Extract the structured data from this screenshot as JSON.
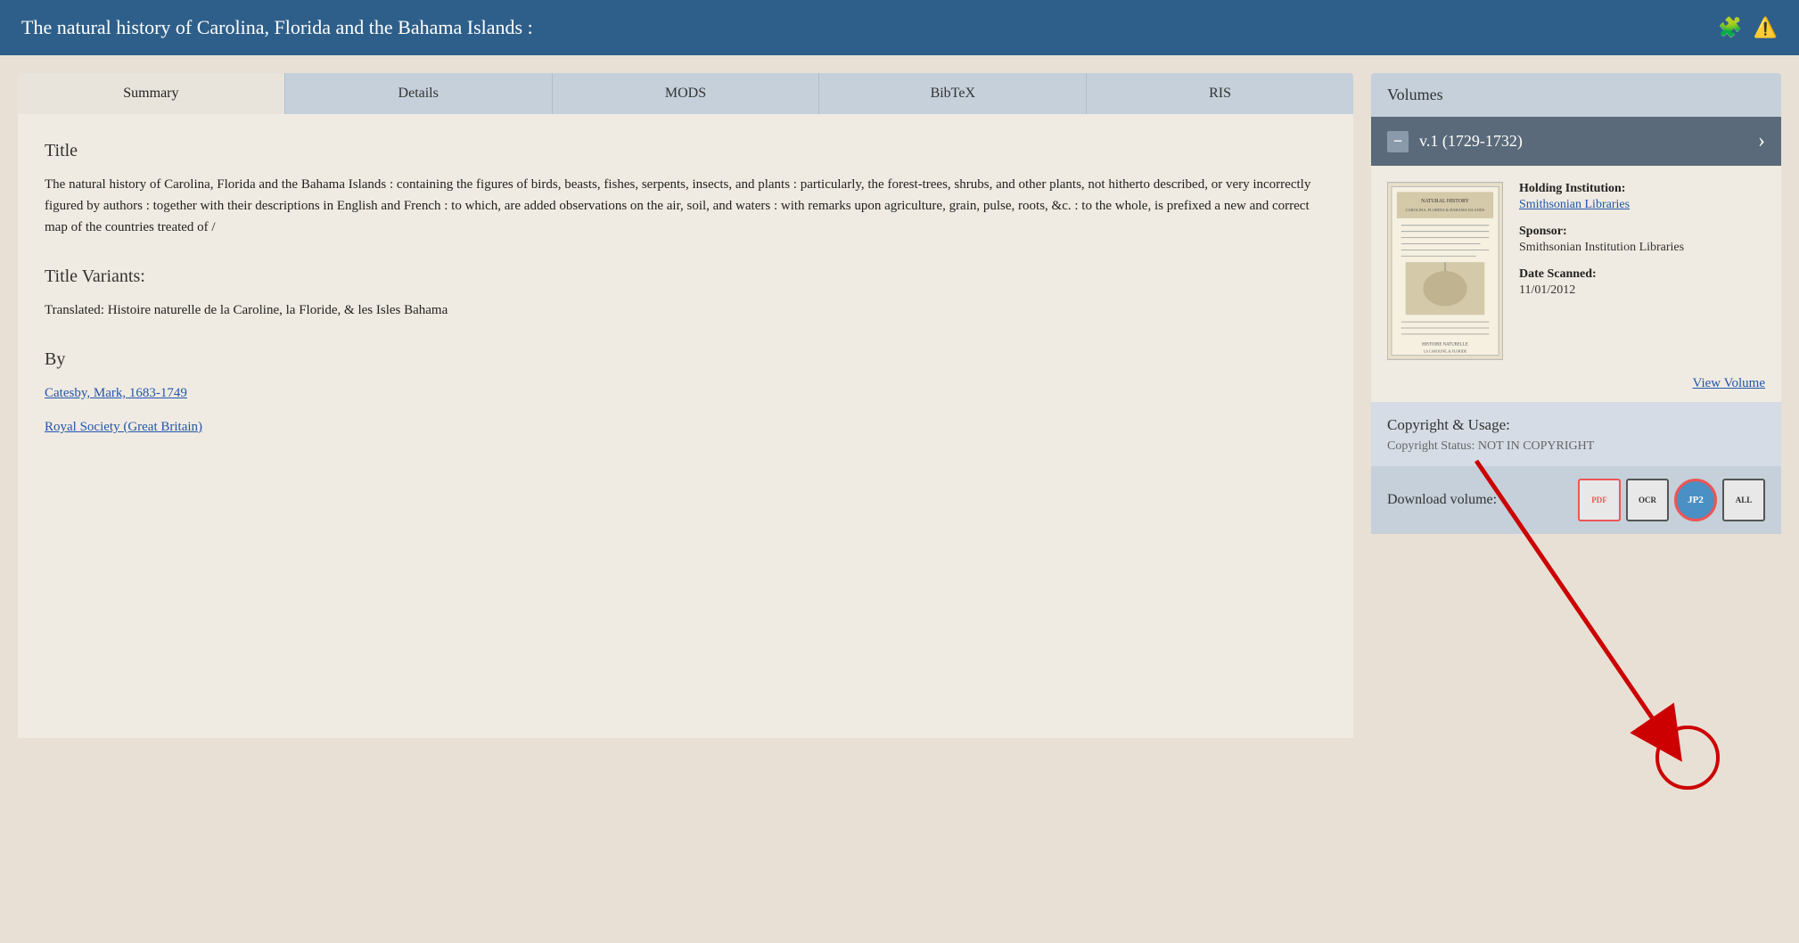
{
  "header": {
    "title": "The natural history of Carolina, Florida and the Bahama Islands :",
    "icons": [
      "puzzle-icon",
      "warning-icon"
    ]
  },
  "tabs": [
    {
      "label": "Summary",
      "active": true
    },
    {
      "label": "Details",
      "active": false
    },
    {
      "label": "MODS",
      "active": false
    },
    {
      "label": "BibTeX",
      "active": false
    },
    {
      "label": "RIS",
      "active": false
    }
  ],
  "summary": {
    "title_label": "Title",
    "title_text": "The natural history of Carolina, Florida and the Bahama Islands : containing the figures of birds, beasts, fishes, serpents, insects, and plants : particularly, the forest-trees, shrubs, and other plants, not hitherto described, or very incorrectly figured by authors : together with their descriptions in English and French : to which, are added observations on the air, soil, and waters : with remarks upon agriculture, grain, pulse, roots, &c. : to the whole, is prefixed a new and correct map of the countries treated of /",
    "title_variants_label": "Title Variants:",
    "title_variants_text": "Translated: Histoire naturelle de la Caroline, la Floride, & les Isles Bahama",
    "by_label": "By",
    "author1": "Catesby, Mark, 1683-1749 ",
    "author2": "Royal Society (Great Britain) "
  },
  "right_panel": {
    "volumes_label": "Volumes",
    "volume": {
      "title": "v.1 (1729-1732)",
      "minus_label": "−",
      "chevron": "›",
      "holding_institution_label": "Holding Institution:",
      "holding_institution_value": "Smithsonian Libraries",
      "sponsor_label": "Sponsor:",
      "sponsor_value": "Smithsonian Institution Libraries",
      "date_scanned_label": "Date Scanned:",
      "date_scanned_value": "11/01/2012",
      "view_volume_label": "View Volume"
    },
    "copyright": {
      "title": "Copyright & Usage:",
      "status_label": "Copyright Status:",
      "status_value": "NOT IN COPYRIGHT"
    },
    "download": {
      "label": "Download volume:",
      "pdf_label": "PDF",
      "ocr_label": "OCR",
      "jp2_label": "JP2",
      "all_label": "ALL"
    }
  }
}
